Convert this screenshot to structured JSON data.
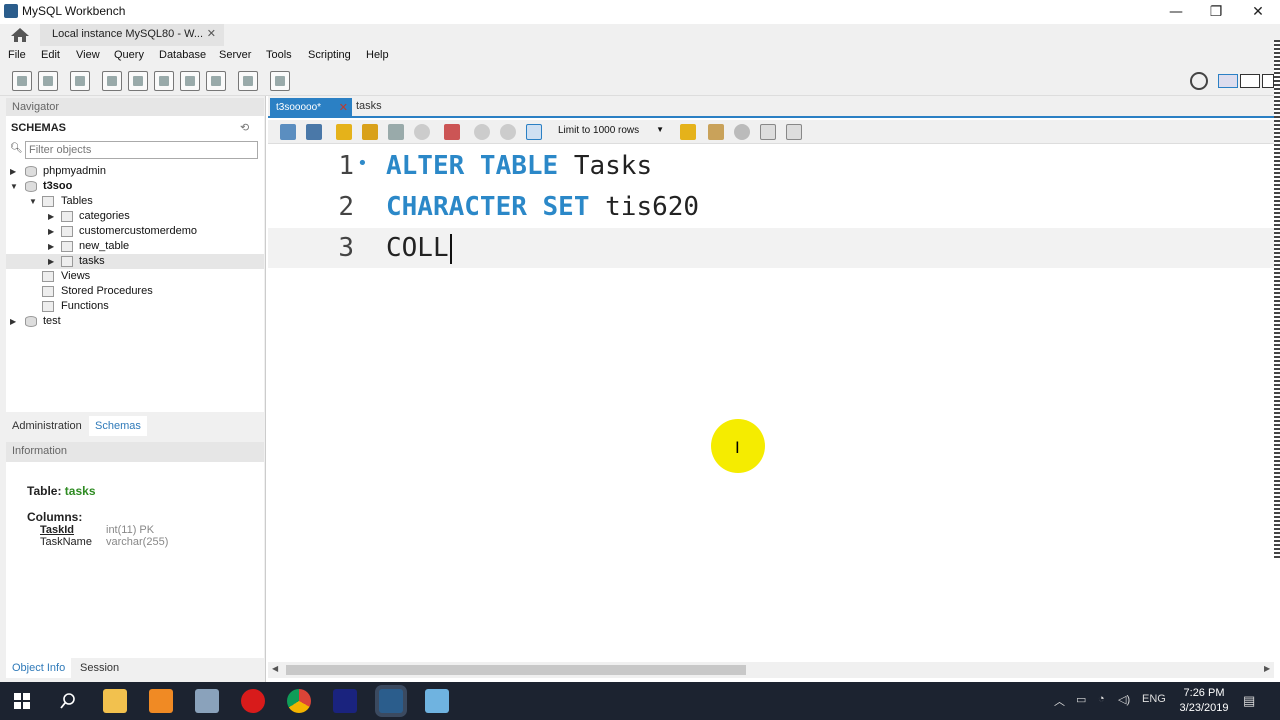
{
  "window": {
    "title": "MySQL Workbench",
    "connection_tab": "Local instance MySQL80 - W...",
    "close_glyph": "✕"
  },
  "menu": [
    "File",
    "Edit",
    "View",
    "Query",
    "Database",
    "Server",
    "Tools",
    "Scripting",
    "Help"
  ],
  "navigator": {
    "header": "Navigator",
    "schemas_title": "SCHEMAS",
    "filter_placeholder": "Filter objects",
    "tree": [
      {
        "label": "phpmyadmin",
        "level": 0,
        "expanded": false,
        "type": "db"
      },
      {
        "label": "t3soo",
        "level": 0,
        "expanded": true,
        "type": "db",
        "bold": true
      },
      {
        "label": "Tables",
        "level": 1,
        "expanded": true,
        "type": "folder"
      },
      {
        "label": "categories",
        "level": 2,
        "expanded": false,
        "type": "table"
      },
      {
        "label": "customercustomerdemo",
        "level": 2,
        "expanded": false,
        "type": "table"
      },
      {
        "label": "new_table",
        "level": 2,
        "expanded": false,
        "type": "table"
      },
      {
        "label": "tasks",
        "level": 2,
        "expanded": false,
        "type": "table",
        "selected": true
      },
      {
        "label": "Views",
        "level": 1,
        "type": "folder"
      },
      {
        "label": "Stored Procedures",
        "level": 1,
        "type": "folder"
      },
      {
        "label": "Functions",
        "level": 1,
        "type": "folder"
      },
      {
        "label": "test",
        "level": 0,
        "expanded": false,
        "type": "db"
      }
    ],
    "tabs": {
      "administration": "Administration",
      "schemas": "Schemas"
    }
  },
  "information": {
    "header": "Information",
    "table_label": "Table:",
    "table_name": "tasks",
    "columns_label": "Columns:",
    "columns": [
      {
        "name": "TaskId",
        "type": "int(11) PK"
      },
      {
        "name": "TaskName",
        "type": "varchar(255)"
      }
    ],
    "bottom_tabs": {
      "object_info": "Object Info",
      "session": "Session"
    }
  },
  "editor": {
    "tabs": [
      {
        "label": "t3sooooo*",
        "active": true
      },
      {
        "label": "tasks",
        "active": false
      }
    ],
    "limit_select": "Limit to 1000 rows",
    "lines": [
      {
        "n": "1",
        "fold": "•",
        "tokens": [
          {
            "t": "ALTER TABLE",
            "kw": true
          },
          {
            "t": " Tasks",
            "kw": false
          }
        ]
      },
      {
        "n": "2",
        "fold": "",
        "tokens": [
          {
            "t": "CHARACTER SET",
            "kw": true
          },
          {
            "t": " tis620",
            "kw": false
          }
        ]
      },
      {
        "n": "3",
        "fold": "",
        "tokens": [
          {
            "t": "COLL",
            "kw": false
          }
        ],
        "current": true
      }
    ]
  },
  "colors": {
    "accent": "#2b80c4",
    "keyword": "#2b88c8",
    "table_name_green": "#2e8b22",
    "cursor_highlight": "#f5ec00"
  },
  "taskbar": {
    "time": "7:26 PM",
    "date": "3/23/2019",
    "language": "ENG"
  }
}
